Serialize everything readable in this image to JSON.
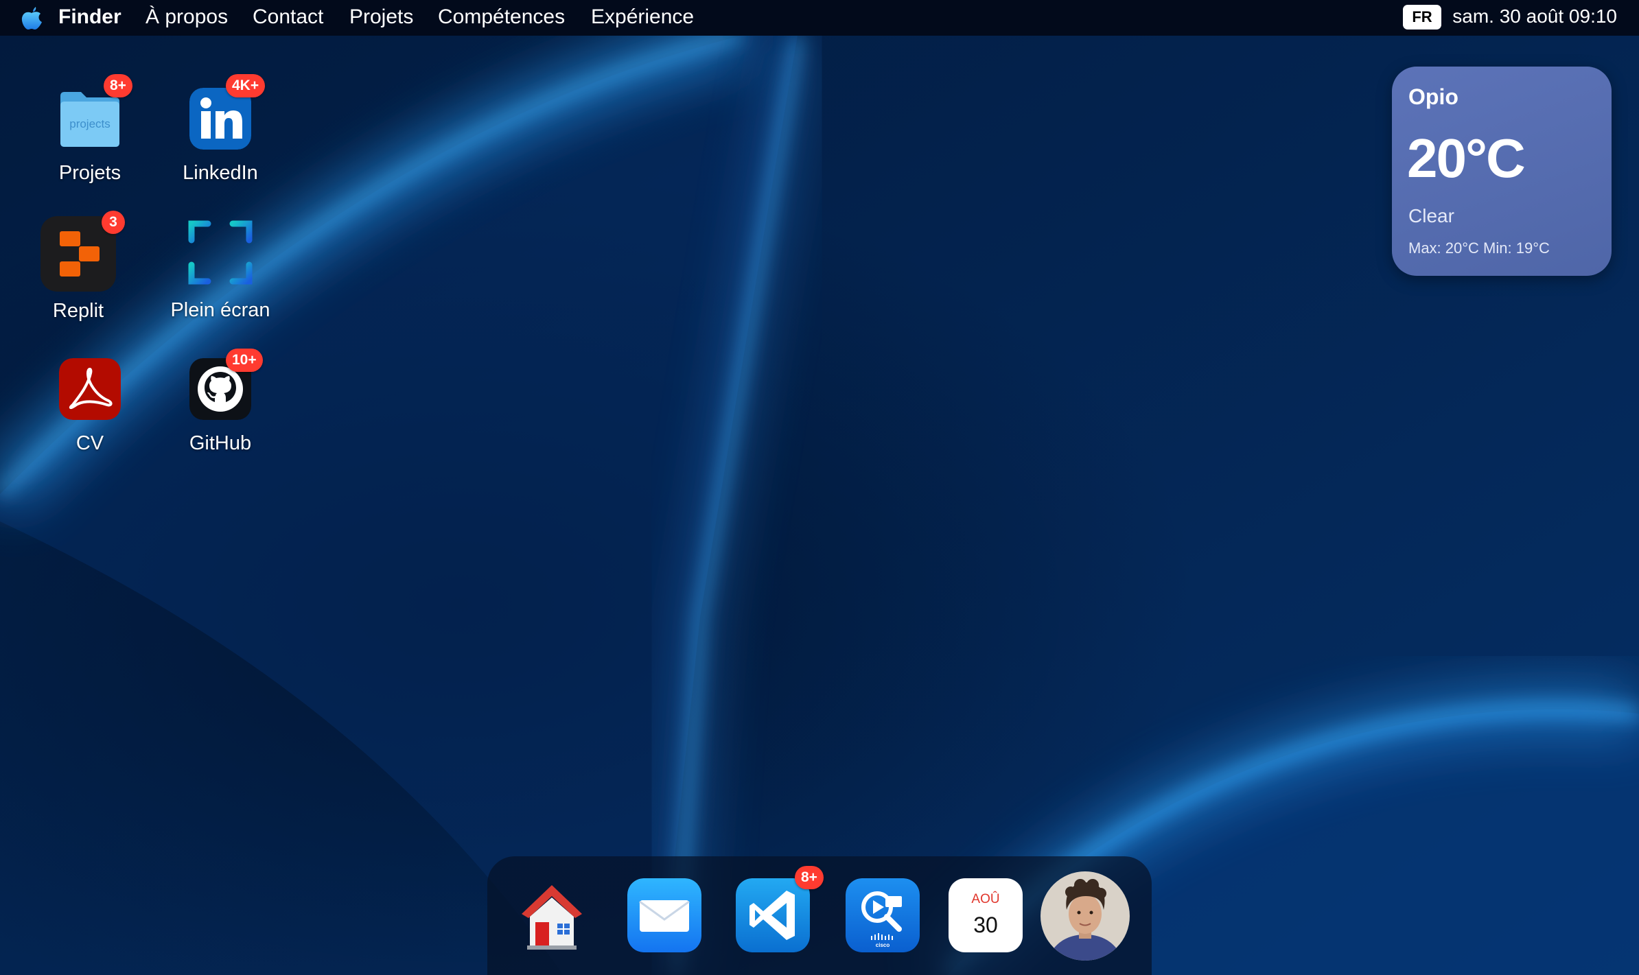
{
  "menubar": {
    "app_name": "Finder",
    "items": [
      "À propos",
      "Contact",
      "Projets",
      "Compétences",
      "Expérience"
    ],
    "language": "FR",
    "clock": "sam. 30 août 09:10"
  },
  "desktop_icons": [
    {
      "label": "Projets",
      "badge": "8+",
      "icon": "folder-icon",
      "folder_text": "projects"
    },
    {
      "label": "LinkedIn",
      "badge": "4K+",
      "icon": "linkedin-icon"
    },
    {
      "label": "Replit",
      "badge": "3",
      "icon": "replit-icon"
    },
    {
      "label": "Plein écran",
      "badge": null,
      "icon": "fullscreen-icon"
    },
    {
      "label": "CV",
      "badge": null,
      "icon": "pdf-icon"
    },
    {
      "label": "GitHub",
      "badge": "10+",
      "icon": "github-icon"
    }
  ],
  "weather": {
    "city": "Opio",
    "temperature": "20°C",
    "condition": "Clear",
    "minmax": "Max: 20°C  Min: 19°C"
  },
  "dock": {
    "items": [
      {
        "icon": "home-icon"
      },
      {
        "icon": "mail-icon"
      },
      {
        "icon": "vscode-icon",
        "badge": "8+"
      },
      {
        "icon": "cisco-webex-icon",
        "caption": "cisco"
      },
      {
        "icon": "calendar-icon",
        "month": "AOÛ",
        "day": "30"
      },
      {
        "icon": "avatar-photo"
      }
    ]
  },
  "colors": {
    "badge": "#ff3b30",
    "menubar": "#020a1b",
    "wallpaper": "#03204d",
    "widget": "#5c73b8"
  }
}
